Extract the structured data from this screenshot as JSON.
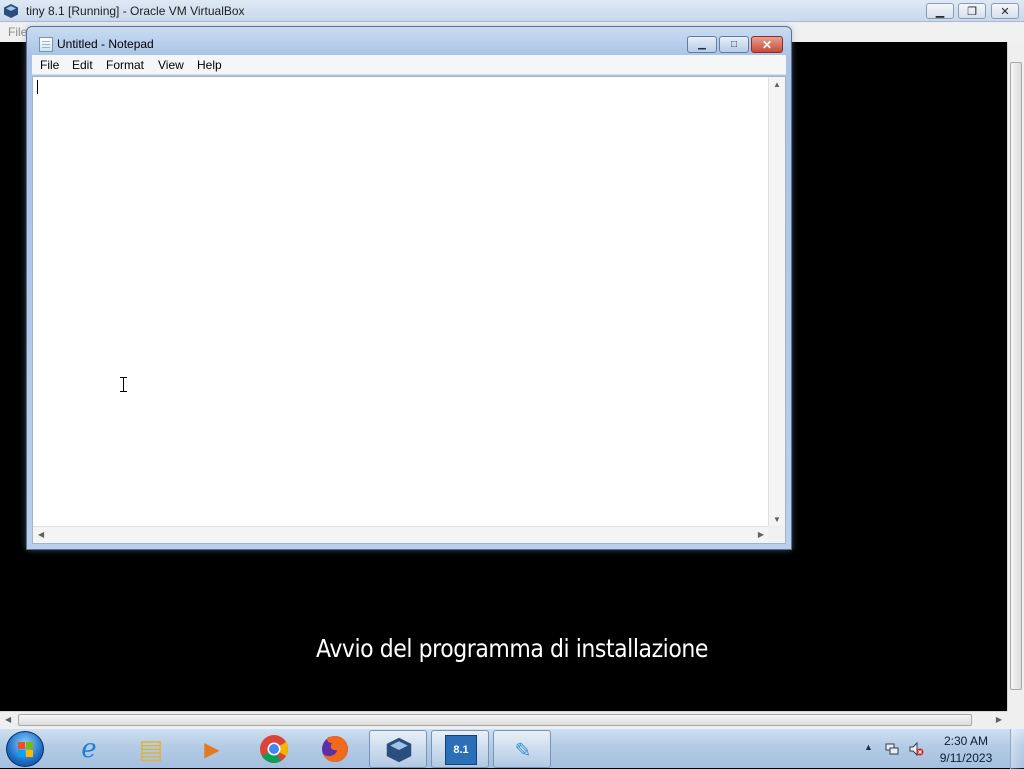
{
  "host": {
    "title": "tiny 8.1 [Running] - Oracle VM VirtualBox",
    "menu_file": "File",
    "icon": "virtualbox-icon",
    "controls": {
      "minimize": "▁",
      "restore": "❐",
      "close": "✕"
    }
  },
  "notepad": {
    "title": "Untitled - Notepad",
    "menu": [
      "File",
      "Edit",
      "Format",
      "View",
      "Help"
    ],
    "content": "",
    "controls": {
      "minimize": "▁",
      "maximize": "□",
      "close": "✕"
    }
  },
  "guest": {
    "install_message": "Avvio del programma di installazione"
  },
  "taskbar": {
    "items": [
      {
        "name": "internet-explorer",
        "glyph": "e",
        "color": "#1f7ed8"
      },
      {
        "name": "file-explorer",
        "glyph": "▤",
        "color": "#e0b23a"
      },
      {
        "name": "media-player",
        "glyph": "▶",
        "color": "#e07b1f"
      },
      {
        "name": "chrome",
        "glyph": "◉",
        "color": "#d9362b"
      },
      {
        "name": "firefox",
        "glyph": "●",
        "color": "#f06a1d"
      },
      {
        "name": "virtualbox",
        "glyph": "◆",
        "color": "#2a4f7e"
      },
      {
        "name": "tiny-8-1-vm",
        "glyph": "8.1",
        "color": "#2b6fb8"
      },
      {
        "name": "notepad",
        "glyph": "✎",
        "color": "#3d8fd0"
      }
    ],
    "clock": {
      "time": "2:30 AM",
      "date": "9/11/2023"
    },
    "tray_chevron": "▲"
  }
}
